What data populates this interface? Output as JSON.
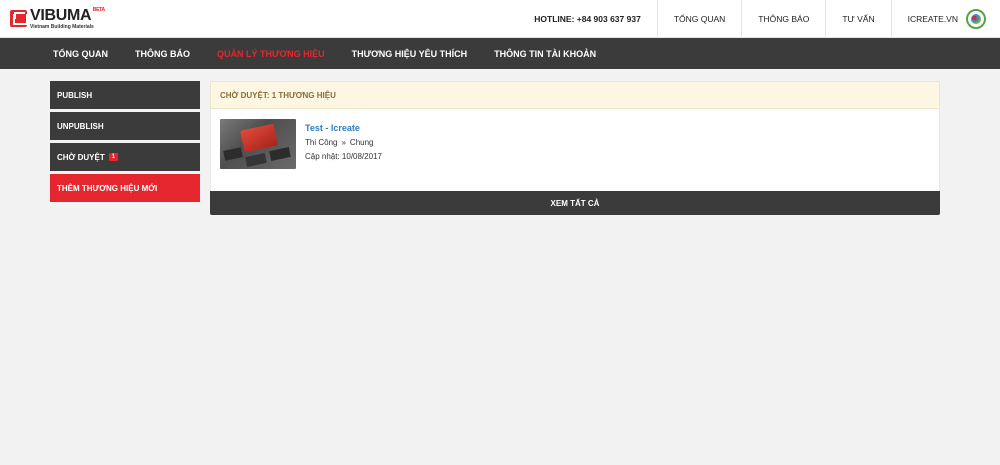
{
  "brand": {
    "name": "VIBUMA",
    "beta": "BETA",
    "tagline": "Vietnam Building Materials"
  },
  "topbar": {
    "hotline": "HOTLINE: +84 903 637 937",
    "links": [
      "TỔNG QUAN",
      "THÔNG BÁO",
      "TƯ VẤN"
    ],
    "user": "ICREATE.VN"
  },
  "nav": {
    "items": [
      "TỔNG QUAN",
      "THÔNG BÁO",
      "QUẢN LÝ THƯƠNG HIỆU",
      "THƯƠNG HIỆU YÊU THÍCH",
      "THÔNG TIN TÀI KHOẢN"
    ],
    "active_index": 2
  },
  "sidebar": {
    "publish": "PUBLISH",
    "unpublish": "UNPUBLISH",
    "pending": "CHỜ DUYỆT",
    "pending_count": "1",
    "add_new": "THÊM THƯƠNG HIỆU MỚI"
  },
  "panel": {
    "header": "CHỜ DUYỆT: 1 THƯƠNG HIỆU",
    "item": {
      "title": "Test - Icreate",
      "category": "Thi Công",
      "separator": "»",
      "subcategory": "Chung",
      "updated": "Cập nhật: 10/08/2017"
    },
    "view_all": "XEM TẤT CẢ"
  },
  "colors": {
    "accent": "#e6262e",
    "dark": "#3b3b3b",
    "link": "#2e7ec3"
  }
}
